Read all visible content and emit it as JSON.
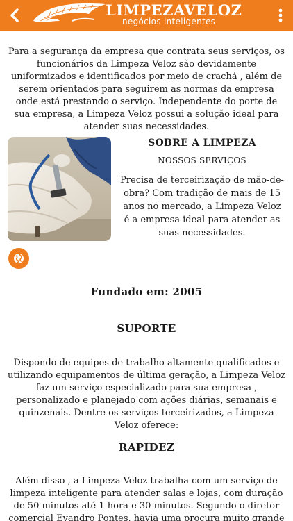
{
  "header": {
    "brand_part1": "LIMPEZA",
    "brand_part2": "VELOZ",
    "tagline": "negócios inteligentes",
    "back_icon": "chevron-left-icon",
    "menu_icon": "kebab-menu-icon",
    "accent_color": "#ef7c1d"
  },
  "intro": {
    "text": "Para a segurança da empresa que contrata seus serviços, os funcionários da Limpeza Veloz são devidamente uniformizados e identificados por meio de crachá , além de serem orientados para seguirem as normas da empresa onde está prestando o serviço. Independente do porte de sua empresa, a Limpeza Veloz possui a solução ideal para atender suas necessidades."
  },
  "about": {
    "title": "SOBRE A LIMPEZA",
    "subtitle": "NOSSOS SERVIÇOS",
    "text": "Precisa de terceirização de mão-de-obra? Com tradição de mais de 15 anos no mercado, a Limpeza Veloz é a empresa ideal para atender as suas necessidades.",
    "globe_icon": "globe-icon"
  },
  "founded": {
    "text": "Fundado em: 2005"
  },
  "suporte": {
    "title": "SUPORTE",
    "text": "Dispondo de equipes de trabalho altamente qualificados e utilizando equipamentos de última geração, a Limpeza Veloz faz um serviço especializado para sua empresa , personalizado e planejado com ações diárias, semanais e quinzenais. Dentre os serviços terceirizados, a Limpeza Veloz oferece:"
  },
  "rapidez": {
    "title": "RAPIDEZ",
    "text": "Além disso , a Limpeza Veloz trabalha com um serviço de limpeza inteligente para atender salas e lojas, com duração de 50 minutos até 1 hora e 30 minutos. Segundo o diretor comercial Evandro Pontes, havia uma procura muito grande para escritórios de pequeno porte que não"
  }
}
